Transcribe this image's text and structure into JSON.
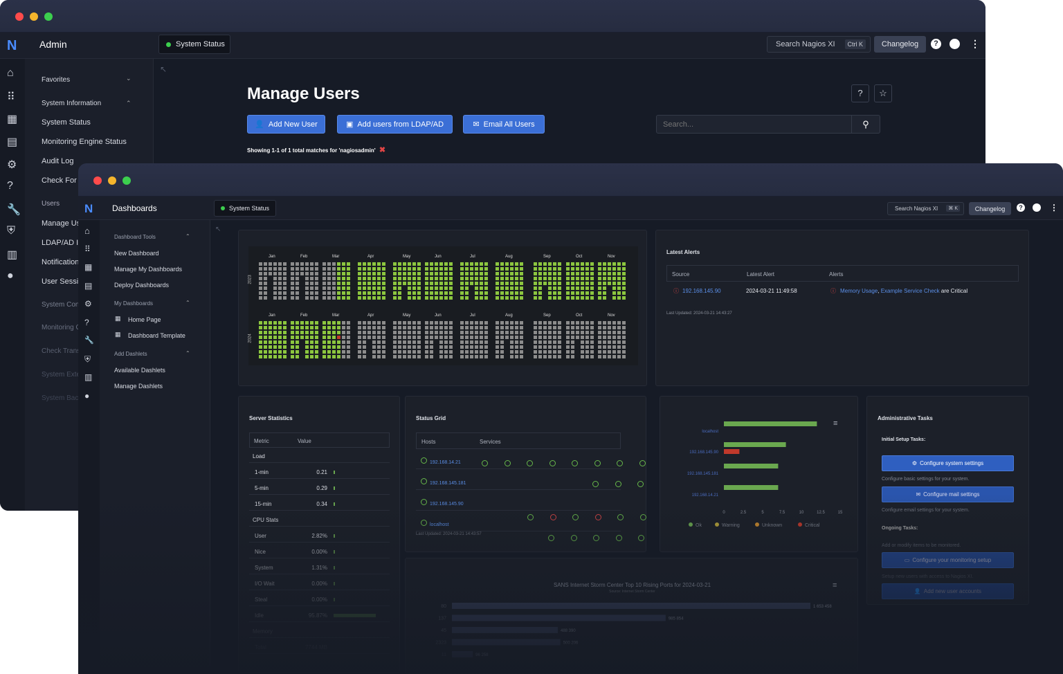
{
  "back": {
    "app_title": "Admin",
    "status_button": "System Status",
    "search_label": "Search Nagios XI",
    "search_shortcut": "Ctrl K",
    "changelog": "Changelog",
    "menu": {
      "favorites": "Favorites",
      "system_information": "System Information",
      "items": [
        "System Status",
        "Monitoring Engine Status",
        "Audit Log",
        "Check For U"
      ],
      "users_head": "Users",
      "user_items": [
        "Manage Us",
        "LDAP/AD In",
        "Notification",
        "User Sessi"
      ],
      "more_items": [
        "System Con",
        "Monitoring C",
        "Check Trans",
        "System Exte",
        "System Bac"
      ]
    },
    "page_title": "Manage Users",
    "buttons": {
      "add_user": "Add New User",
      "ldap": "Add users from LDAP/AD",
      "email": "Email All Users"
    },
    "search_placeholder": "Search...",
    "showing": "Showing 1-1 of 1 total matches for 'nagiosadmin'"
  },
  "front": {
    "app_title": "Dashboards",
    "status_button": "System Status",
    "search_label": "Search Nagios XI",
    "search_shortcut": "⌘ K",
    "changelog": "Changelog",
    "menu": {
      "dashboard_tools": "Dashboard Tools",
      "tools_items": [
        "New Dashboard",
        "Manage My Dashboards",
        "Deploy Dashboards"
      ],
      "my_dashboards": "My Dashboards",
      "my_items": [
        "Home Page",
        "Dashboard Template"
      ],
      "add_dashlets": "Add Dashlets",
      "dashlet_items": [
        "Available Dashlets",
        "Manage Dashlets"
      ]
    },
    "heatmap": {
      "months": [
        "Jan",
        "Feb",
        "Mar",
        "Apr",
        "May",
        "Jun",
        "Jul",
        "Aug",
        "Sep",
        "Oct",
        "Nov"
      ],
      "years": [
        "2023",
        "2024"
      ]
    },
    "latest_alerts": {
      "title": "Latest Alerts",
      "headers": [
        "Source",
        "Latest Alert",
        "Alerts"
      ],
      "row": {
        "source": "192.168.145.90",
        "time": "2024-03-21 11:49:58",
        "alert1": "Memory Usage",
        "sep": ",",
        "alert2": "Example Service Check",
        "suffix": "are Critical"
      },
      "updated": "Last Updated: 2024-03-21 14:43:27"
    },
    "server_stats": {
      "title": "Server Statistics",
      "headers": [
        "Metric",
        "Value"
      ],
      "rows": [
        {
          "label": "Load",
          "value": "",
          "bar": 0,
          "section": true
        },
        {
          "label": "1-min",
          "value": "0.21",
          "bar": 0.02
        },
        {
          "label": "5-min",
          "value": "0.29",
          "bar": 0.02
        },
        {
          "label": "15-min",
          "value": "0.34",
          "bar": 0.02
        },
        {
          "label": "CPU Stats",
          "value": "",
          "bar": 0,
          "section": true
        },
        {
          "label": "User",
          "value": "2.82%",
          "bar": 0.03
        },
        {
          "label": "Nice",
          "value": "0.00%",
          "bar": 0.01
        },
        {
          "label": "System",
          "value": "1.31%",
          "bar": 0.02
        },
        {
          "label": "I/O Wait",
          "value": "0.00%",
          "bar": 0.01
        },
        {
          "label": "Steal",
          "value": "0.00%",
          "bar": 0.01
        },
        {
          "label": "Idle",
          "value": "95.87%",
          "bar": 0.96
        },
        {
          "label": "Memory",
          "value": "",
          "bar": 0,
          "section": true
        },
        {
          "label": "Total",
          "value": "7744 MB",
          "bar": 0
        }
      ]
    },
    "status_grid": {
      "title": "Status Grid",
      "headers": [
        "Hosts",
        "Services"
      ],
      "rows": [
        {
          "host": "192.168.14.21",
          "services": [
            "ok",
            "ok",
            "ok",
            "ok",
            "ok",
            "ok",
            "ok",
            "ok",
            "ok",
            "ok"
          ]
        },
        {
          "host": "192.168.145.181",
          "services": [
            "ok",
            "ok",
            "ok",
            "ok",
            "ok",
            "ok",
            "ok"
          ]
        },
        {
          "host": "192.168.145.90",
          "services": [
            "ok",
            "ok",
            "ok",
            "ok",
            "ok",
            "crit",
            "ok",
            "crit",
            "ok",
            "ok"
          ]
        },
        {
          "host": "localhost",
          "services": [
            "ok",
            "ok",
            "ok",
            "ok",
            "ok",
            "ok",
            "ok",
            "ok",
            "ok",
            "ok",
            "ok",
            "ok"
          ]
        }
      ],
      "updated": "Last Updated: 2024-03-21 14:43:57"
    },
    "host_chart": {
      "chart_data": {
        "type": "bar",
        "categories": [
          "localhost",
          "192.168.145.90",
          "192.168.145.181",
          "192.168.14.21"
        ],
        "series": [
          {
            "name": "Ok",
            "values": [
              12,
              8,
              7,
              7
            ]
          },
          {
            "name": "Warning",
            "values": [
              0,
              0,
              0,
              0
            ]
          },
          {
            "name": "Unknown",
            "values": [
              0,
              0,
              0,
              0
            ]
          },
          {
            "name": "Critical",
            "values": [
              0,
              2,
              0,
              0
            ]
          }
        ],
        "xticks": [
          "0",
          "2.5",
          "5",
          "7.5",
          "10",
          "12.5",
          "15"
        ],
        "xlim": [
          0,
          15
        ]
      },
      "colors": {
        "ok": "#6aa84f",
        "warning": "#b5a23a",
        "unknown": "#c8892e",
        "critical": "#c0392b"
      }
    },
    "admin_tasks": {
      "title": "Administrative Tasks",
      "initial": "Initial Setup Tasks:",
      "btn1": "Configure system settings",
      "desc1": "Configure basic settings for your system.",
      "btn2": "Configure mail settings",
      "desc2": "Configure email settings for your system.",
      "ongoing": "Ongoing Tasks:",
      "desc3": "Add or modify items to be monitored.",
      "btn3": "Configure your monitoring setup",
      "desc4": "Setup new users with access to Nagios XI.",
      "btn4": "Add new user accounts"
    },
    "sans_chart": {
      "title": "SANS Internet Storm Center Top 10 Rising Ports for 2024-03-21",
      "subtitle": "Source: Internet Storm Center",
      "chart_data": {
        "type": "bar",
        "categories": [
          "80",
          "137",
          "45",
          "2323",
          "11"
        ],
        "values": [
          1653458,
          985854,
          488390,
          500206,
          96258
        ],
        "labels": [
          "1 653 458",
          "985 854",
          "488 390",
          "500 206",
          "96 258"
        ]
      }
    }
  }
}
